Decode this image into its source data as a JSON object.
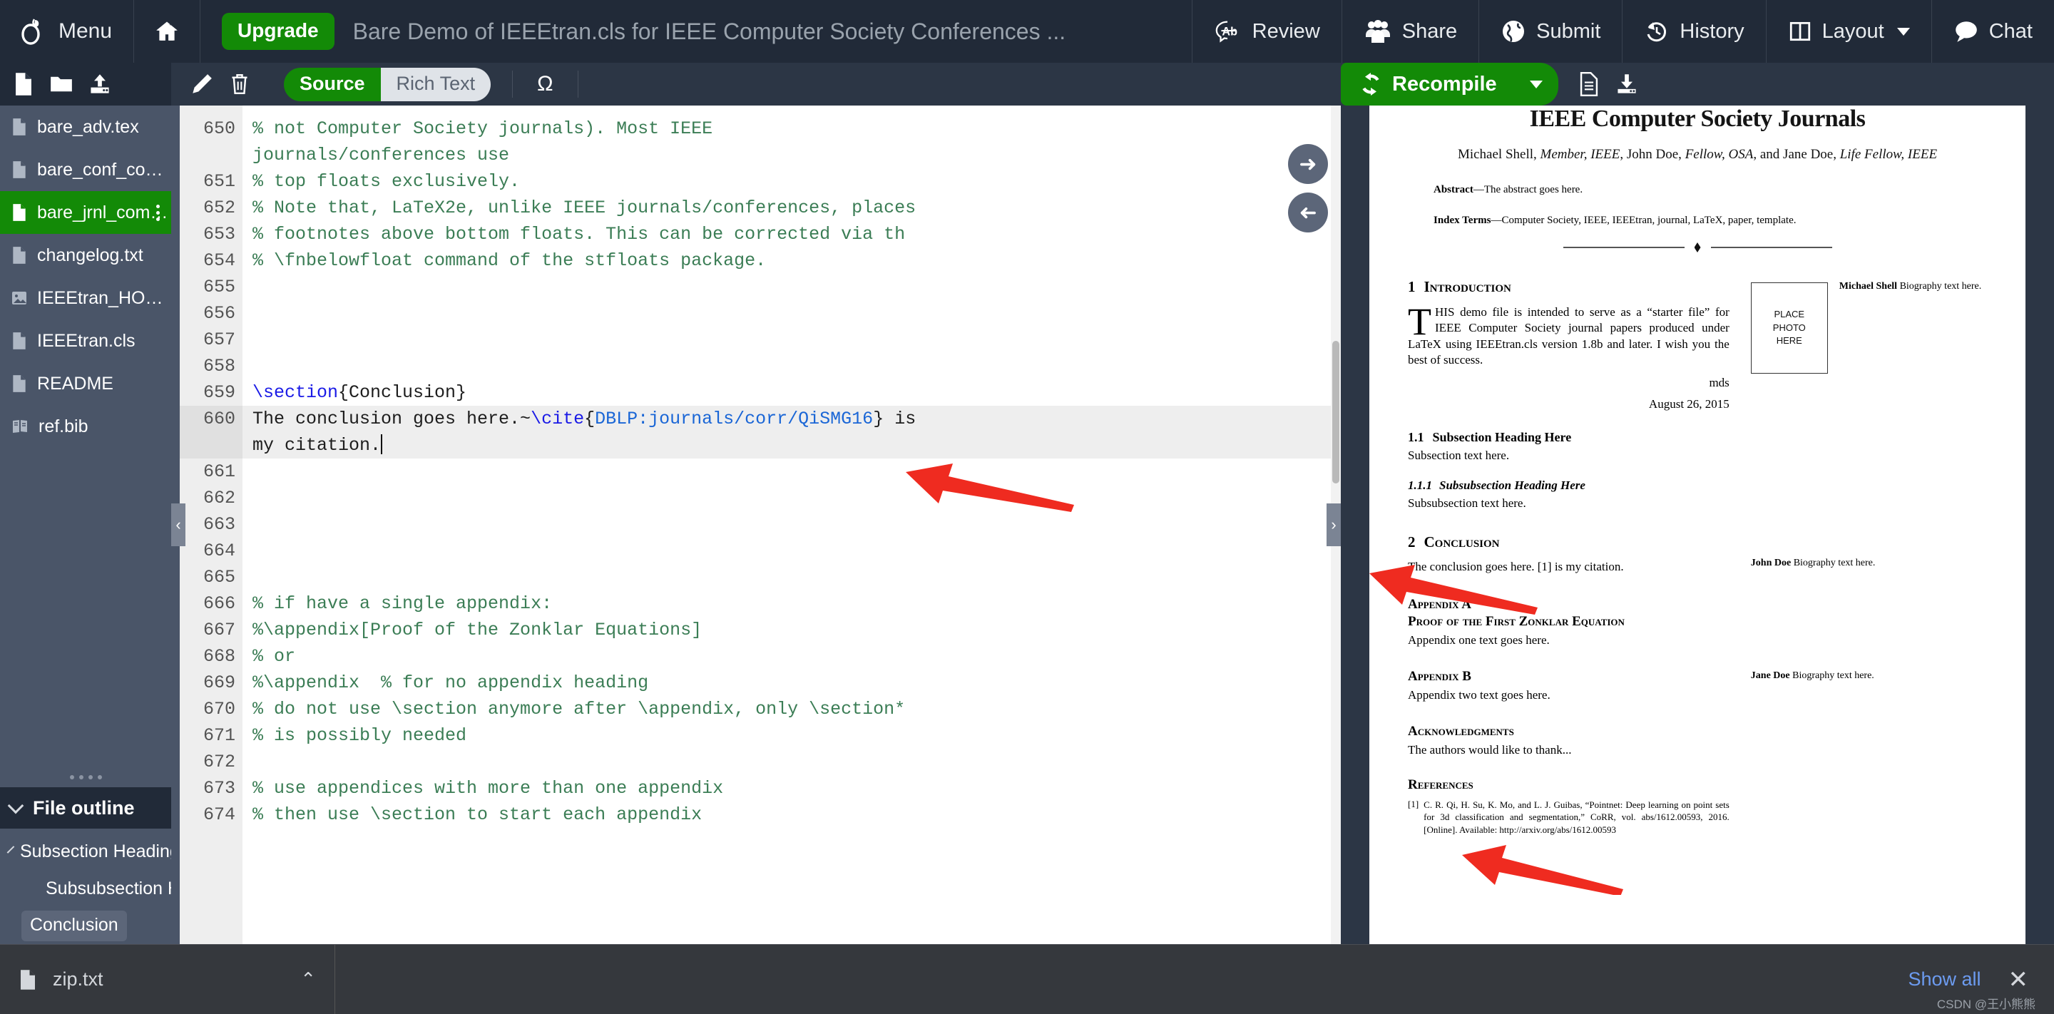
{
  "topnav": {
    "menu_label": "Menu",
    "menu_icon": "overleaf-logo-icon",
    "home_icon": "home-icon",
    "upgrade_label": "Upgrade",
    "project_title": "Bare Demo of IEEEtran.cls for IEEE Computer Society Conferences ...",
    "actions": [
      {
        "label": "Review",
        "icon": "review-ab-icon"
      },
      {
        "label": "Share",
        "icon": "users-share-icon"
      },
      {
        "label": "Submit",
        "icon": "globe-submit-icon"
      },
      {
        "label": "History",
        "icon": "history-clock-icon"
      },
      {
        "label": "Layout",
        "icon": "layout-columns-icon",
        "caret": "▾"
      },
      {
        "label": "Chat",
        "icon": "chat-bubble-icon"
      }
    ]
  },
  "toolbar": {
    "file_icons": [
      {
        "name": "new-file-icon"
      },
      {
        "name": "new-folder-icon"
      },
      {
        "name": "upload-icon"
      }
    ],
    "editor_icons": [
      {
        "name": "rename-pencil-icon"
      },
      {
        "name": "delete-trash-icon"
      }
    ],
    "mode_toggle": {
      "source_label": "Source",
      "richtext_label": "Rich Text",
      "selected": "Source"
    },
    "symbol_palette_label": "Ω",
    "recompile_label": "Recompile",
    "recompile_icon": "recompile-refresh-icon",
    "recompile_caret": "▾",
    "pdf_icons": [
      {
        "name": "logs-file-icon"
      },
      {
        "name": "download-pdf-icon"
      }
    ]
  },
  "sidebar": {
    "files": [
      {
        "name": "bare_adv.tex",
        "icon": "file-icon",
        "active": false
      },
      {
        "name": "bare_conf_compsoc.tex",
        "icon": "file-icon",
        "active": false
      },
      {
        "name": "bare_jrnl_comps...",
        "icon": "file-icon",
        "active": true
      },
      {
        "name": "changelog.txt",
        "icon": "file-icon",
        "active": false
      },
      {
        "name": "IEEEtran_HOWTO.pdf",
        "icon": "image-file-icon",
        "active": false
      },
      {
        "name": "IEEEtran.cls",
        "icon": "file-icon",
        "active": false
      },
      {
        "name": "README",
        "icon": "file-icon",
        "active": false
      },
      {
        "name": "ref.bib",
        "icon": "bib-file-icon",
        "active": false
      }
    ],
    "outline": {
      "title": "File outline",
      "items": [
        {
          "label": "Subsection Heading Here",
          "level": 1,
          "selected": false
        },
        {
          "label": "Subsubsection Headi...",
          "level": 2,
          "selected": false
        },
        {
          "label": "Conclusion",
          "level": 1,
          "selected": true
        }
      ]
    }
  },
  "editor": {
    "lines": [
      {
        "num": "650",
        "text": "% not Computer Society journals). Most IEEE",
        "style": "comment"
      },
      {
        "num": "",
        "text": "journals/conferences use",
        "style": "comment-wrap"
      },
      {
        "num": "651",
        "text": "% top floats exclusively.",
        "style": "comment"
      },
      {
        "num": "652",
        "text": "% Note that, LaTeX2e, unlike IEEE journals/conferences, places",
        "style": "comment"
      },
      {
        "num": "653",
        "text": "% footnotes above bottom floats. This can be corrected via th",
        "style": "comment"
      },
      {
        "num": "654",
        "text": "% \\fnbelowfloat command of the stfloats package.",
        "style": "comment-stfloats"
      },
      {
        "num": "655",
        "text": "",
        "style": "plain"
      },
      {
        "num": "656",
        "text": "",
        "style": "plain"
      },
      {
        "num": "657",
        "text": "",
        "style": "plain"
      },
      {
        "num": "658",
        "text": "",
        "style": "plain"
      },
      {
        "num": "659",
        "text": "\\section{Conclusion}",
        "style": "section",
        "fold": true
      },
      {
        "num": "660",
        "text": "The conclusion goes here.~\\cite{DBLP:journals/corr/QiSMG16} is",
        "style": "cite-line",
        "current": true
      },
      {
        "num": "",
        "text": "my citation.",
        "style": "plain-cur",
        "current": true
      },
      {
        "num": "661",
        "text": "",
        "style": "plain"
      },
      {
        "num": "662",
        "text": "",
        "style": "plain"
      },
      {
        "num": "663",
        "text": "",
        "style": "plain"
      },
      {
        "num": "664",
        "text": "",
        "style": "plain"
      },
      {
        "num": "665",
        "text": "",
        "style": "plain"
      },
      {
        "num": "666",
        "text": "% if have a single appendix:",
        "style": "comment"
      },
      {
        "num": "667",
        "text": "%\\appendix[Proof of the Zonklar Equations]",
        "style": "comment-zonklar"
      },
      {
        "num": "668",
        "text": "% or",
        "style": "comment"
      },
      {
        "num": "669",
        "text": "%\\appendix  % for no appendix heading",
        "style": "comment"
      },
      {
        "num": "670",
        "text": "% do not use \\section anymore after \\appendix, only \\section*",
        "style": "comment",
        "fold": true
      },
      {
        "num": "671",
        "text": "% is possibly needed",
        "style": "comment"
      },
      {
        "num": "672",
        "text": "",
        "style": "plain"
      },
      {
        "num": "673",
        "text": "% use appendices with more than one appendix",
        "style": "comment"
      },
      {
        "num": "674",
        "text": "% then use \\section to start each appendix",
        "style": "comment",
        "fold": true
      }
    ],
    "line660_parts": {
      "pre": "The conclusion goes here.~",
      "cmd": "\\cite",
      "brace_open": "{",
      "key": "DBLP:journals/corr/QiSMG16",
      "brace_close": "}",
      "post": " is"
    },
    "line659_parts": {
      "cmd": "\\section",
      "rest": "{Conclusion}"
    },
    "nav_buttons": [
      {
        "name": "goto-pdf-arrow-button",
        "glyph": "➜"
      },
      {
        "name": "goto-code-arrow-button",
        "glyph": "➜"
      }
    ]
  },
  "pdf": {
    "title": "IEEE Computer Society Journals",
    "authors_plain1": "Michael Shell, ",
    "authors_it1": "Member, IEEE",
    "authors_plain2": ", John Doe, ",
    "authors_it2": "Fellow, OSA",
    "authors_plain3": ", and Jane Doe, ",
    "authors_it3": "Life Fellow, IEEE",
    "abstract_label": "Abstract",
    "abstract_text": "—The abstract goes here.",
    "index_label": "Index Terms",
    "index_text": "—Computer Society, IEEE, IEEEtran, journal, LaTeX, paper, template.",
    "sec1_num": "1",
    "sec1_title": "Introduction",
    "intro_drop": "T",
    "intro_small": "HIS",
    "intro_text": " demo file is intended to serve as a “starter file” for IEEE Computer Society journal papers produced under LaTeX using IEEEtran.cls version 1.8b and later. I wish you the best of success.",
    "sig_initials": "mds",
    "sig_date": "August 26, 2015",
    "sub11_num": "1.1",
    "sub11_title": "Subsection Heading Here",
    "sub11_text": "Subsection text here.",
    "sub111_num": "1.1.1",
    "sub111_title": "Subsubsection Heading Here",
    "sub111_text": "Subsubsection text here.",
    "sec2_num": "2",
    "sec2_title": "Conclusion",
    "sec2_text": "The conclusion goes here. [1] is my citation.",
    "appA_title": "Appendix A",
    "appA_sub": "Proof of the First Zonklar Equation",
    "appA_text": "Appendix one text goes here.",
    "appB_title": "Appendix B",
    "appB_text": "Appendix two text goes here.",
    "ack_title": "Acknowledgments",
    "ack_text": "The authors would like to thank...",
    "refs_title": "References",
    "ref1_num": "[1]",
    "ref1_text": "C. R. Qi, H. Su, K. Mo, and L. J. Guibas, “Pointnet: Deep learning on point sets for 3d classification and segmentation,” CoRR, vol. abs/1612.00593, 2016. [Online]. Available: http://arxiv.org/abs/1612.00593",
    "photo_line1": "PLACE",
    "photo_line2": "PHOTO",
    "photo_line3": "HERE",
    "bio1_name": "Michael Shell",
    "bio1_text": " Biography text here.",
    "bio2_name": "John Doe",
    "bio2_text": " Biography text here.",
    "bio3_name": "Jane Doe",
    "bio3_text": " Biography text here.",
    "annotation_color": "#ef2b20"
  },
  "bottombar": {
    "file_name": "zip.txt",
    "file_icon": "file-icon",
    "collapse_caret": "⌃",
    "show_all_label": "Show all",
    "close_label": "✕",
    "watermark": "CSDN @王小熊熊"
  }
}
